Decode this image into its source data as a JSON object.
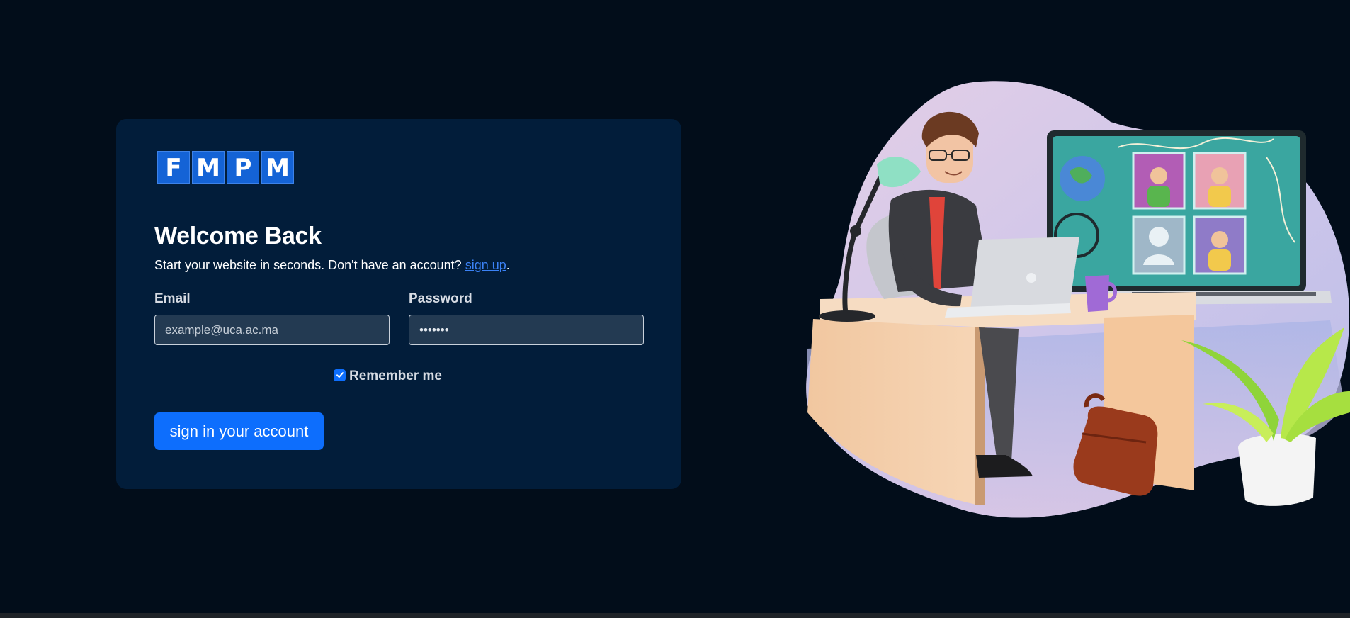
{
  "logo": {
    "letters": [
      "F",
      "M",
      "P",
      "M"
    ]
  },
  "login": {
    "title": "Welcome Back",
    "subtitle_prefix": "Start your website in seconds. Don't have an account?",
    "signup_link": "sign up",
    "subtitle_suffix": ".",
    "email_label": "Email",
    "email_placeholder": "example@uca.ac.ma",
    "email_value": "",
    "password_label": "Password",
    "password_value": "•••••••",
    "remember_label": "Remember me",
    "remember_checked": true,
    "submit_label": "sign in your account"
  },
  "colors": {
    "page_bg": "#020d1a",
    "card_bg": "#021d3a",
    "accent": "#0d6efd",
    "logo_tile": "#1463d6",
    "link": "#3b82f6"
  },
  "icons": {
    "checkbox": "check-icon",
    "illustration": "office-worker-illustration"
  }
}
